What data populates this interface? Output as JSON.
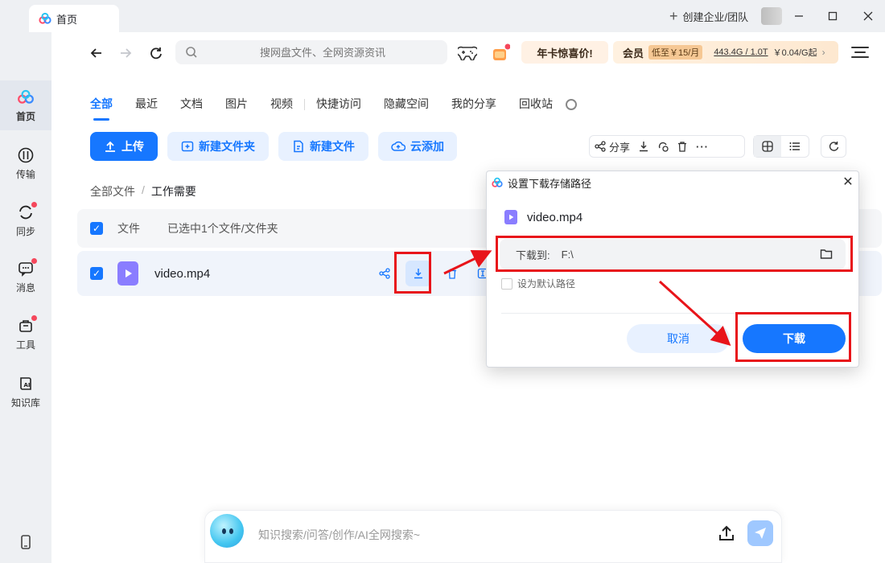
{
  "window": {
    "tab_title": "首页",
    "create_team": "创建企业/团队"
  },
  "sidebar": {
    "items": [
      {
        "label": "首页"
      },
      {
        "label": "传输"
      },
      {
        "label": "同步"
      },
      {
        "label": "消息"
      },
      {
        "label": "工具"
      },
      {
        "label": "知识库"
      }
    ]
  },
  "header": {
    "search_placeholder": "搜网盘文件、全网资源资讯",
    "promo": "年卡惊喜价!",
    "vip_label": "会员",
    "vip_price": "低至￥15/月",
    "quota": "443.4G / 1.0T",
    "rate": "￥0.04/G起"
  },
  "tabs": [
    "全部",
    "最近",
    "文档",
    "图片",
    "视频",
    "快捷访问",
    "隐藏空间",
    "我的分享",
    "回收站"
  ],
  "actions": {
    "upload": "上传",
    "new_folder": "新建文件夹",
    "new_file": "新建文件",
    "cloud_add": "云添加",
    "share": "分享"
  },
  "breadcrumb": {
    "root": "全部文件",
    "sep": "/",
    "current": "工作需要"
  },
  "list": {
    "col_file": "文件",
    "selected_text": "已选中1个文件/文件夹",
    "rows": [
      {
        "name": "video.mp4"
      }
    ]
  },
  "ai": {
    "placeholder": "知识搜索/问答/创作/AI全网搜索~"
  },
  "dialog": {
    "title": "设置下载存储路径",
    "file_name": "video.mp4",
    "path_label": "下载到:",
    "path_value": "F:\\",
    "default_label": "设为默认路径",
    "cancel": "取消",
    "ok": "下载"
  },
  "colors": {
    "accent": "#1677ff",
    "annotation": "#e8141a",
    "video_icon": "#8a7dff"
  }
}
